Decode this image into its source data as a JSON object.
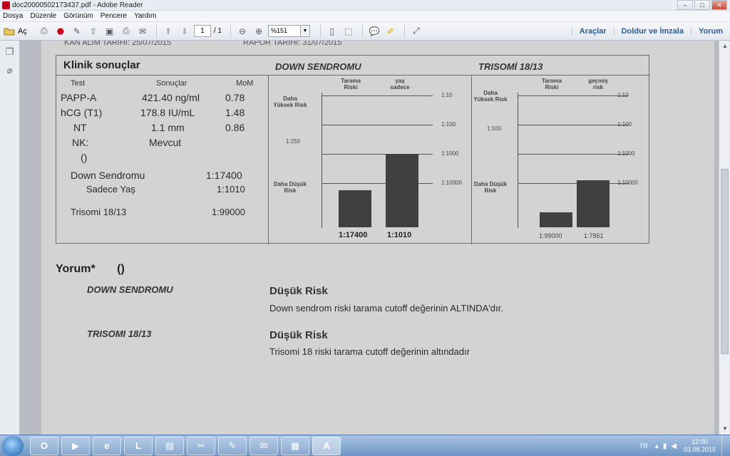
{
  "window": {
    "title": "doc20000502173437.pdf - Adobe Reader",
    "controls": [
      "–",
      "□",
      "✕"
    ]
  },
  "menu": [
    "Dosya",
    "Düzenle",
    "Görünüm",
    "Pencere",
    "Yardım"
  ],
  "toolbar": {
    "open_label": "Aç",
    "page_current": "1",
    "page_total": "/ 1",
    "zoom": "%151",
    "tools_label": "Araçlar",
    "sign_label": "Doldur ve İmzala",
    "comment_label": "Yorum"
  },
  "document": {
    "header_left": "KAN ALIM TARİHİ: 25/07/2015",
    "header_right": "RAPOR TARİHİ: 31/07/2015",
    "results": {
      "title": "Klinik sonuçlar",
      "col_test": "Test",
      "col_results": "Sonuçlar",
      "col_mom": "MoM",
      "rows": [
        {
          "test": "PAPP-A",
          "value": "421.40 ng/ml",
          "mom": "0.78"
        },
        {
          "test": "hCG (T1)",
          "value": "178.8 IU/mL",
          "mom": "1.48"
        },
        {
          "test": "NT",
          "value": "1.1 mm",
          "mom": "0.86"
        },
        {
          "test": "NK:",
          "value": "Mevcut",
          "mom": ""
        },
        {
          "test": "()",
          "value": "",
          "mom": ""
        }
      ],
      "down_label": "Down Sendromu",
      "down_value": "1:17400",
      "age_label": "Sadece Yaş",
      "age_value": "1:1010",
      "trisomy_label": "Trisomi 18/13",
      "trisomy_value": "1:99000"
    },
    "down_chart": {
      "title": "DOWN SENDROMU",
      "col1": "Tarama Riski",
      "col2": "yaş sadece",
      "high_risk": "Daha Yüksek Risk",
      "low_risk": "Daha Düşük Risk",
      "cutoff": "1:250",
      "ticks": [
        "1:10",
        "1:100",
        "1:1000",
        "1:10000"
      ],
      "bar_labels": [
        "1:17400",
        "1:1010"
      ]
    },
    "trisomy_chart": {
      "title": "TRISOMİ 18/13",
      "col1": "Tarama Riski",
      "col2": "geçmiş risk",
      "high_risk": "Daha Yüksek Risk",
      "low_risk": "Daha Düşük Risk",
      "ticks": [
        "1:10",
        "1:100",
        "1:1000",
        "1:10000"
      ],
      "left_tick": "1:100",
      "bar_labels": [
        "1:99000",
        "1:7861"
      ]
    },
    "comments": {
      "title": "Yorum*",
      "title_paren": "()",
      "items": [
        {
          "label": "DOWN SENDROMU",
          "risk": "Düşük Risk",
          "text": "Down sendrom riski tarama cutoff değerinin ALTINDA'dır."
        },
        {
          "label": "TRISOMI 18/13",
          "risk": "Düşük Risk",
          "text": "Trisomi 18 riski tarama cutoff değerinin altındadır"
        }
      ]
    }
  },
  "chart_data": [
    {
      "type": "bar",
      "title": "DOWN SENDROMU",
      "categories": [
        "1:17400",
        "1:1010"
      ],
      "values": [
        17400,
        1010
      ],
      "y_scale": "log-reciprocal",
      "ylabel": "",
      "ticks": [
        "1:10",
        "1:100",
        "1:1000",
        "1:10000"
      ]
    },
    {
      "type": "bar",
      "title": "TRISOMİ 18/13",
      "categories": [
        "1:99000",
        "1:7861"
      ],
      "values": [
        99000,
        7861
      ],
      "y_scale": "log-reciprocal",
      "ticks": [
        "1:10",
        "1:100",
        "1:1000",
        "1:10000"
      ]
    }
  ],
  "taskbar": {
    "apps": [
      "Outlook",
      "Media Player",
      "Internet Explorer",
      "Lync",
      "Sticky Notes",
      "Snipping Tool",
      "Journal",
      "Mail",
      "Explorer",
      "Adobe Reader"
    ],
    "app_glyphs": [
      "O",
      "▶",
      "e",
      "L",
      "▤",
      "✂",
      "✎",
      "✉",
      "▦",
      "A"
    ],
    "lang": "TR",
    "time": "12:00",
    "date": "03.08.2015"
  }
}
